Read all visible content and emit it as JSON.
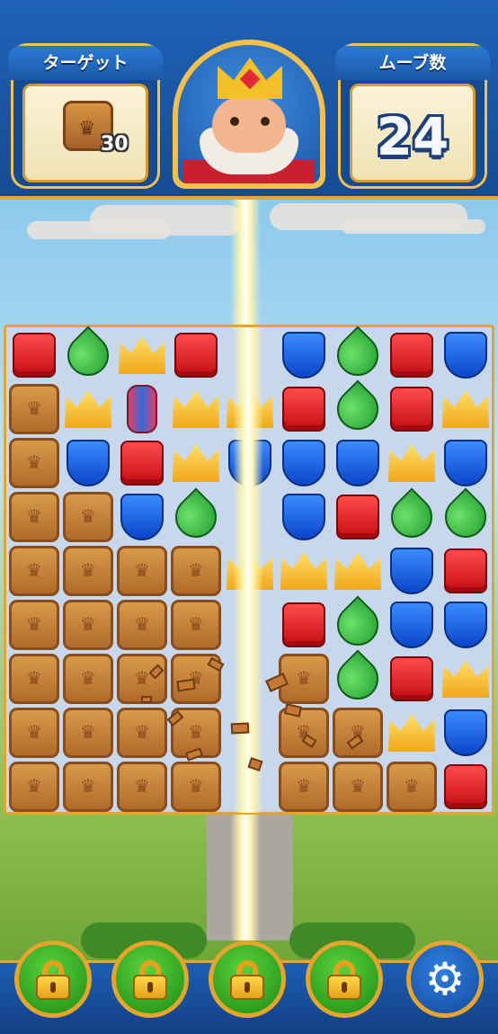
{
  "hud": {
    "target_label": "ターゲット",
    "target_count": "30",
    "moves_label": "ムーブ数",
    "moves_count": "24"
  },
  "board": {
    "columns": 9,
    "rows": 9,
    "grid": [
      [
        "red",
        "green",
        "crown",
        "red",
        "empty",
        "blue",
        "green",
        "red",
        "blue"
      ],
      [
        "box",
        "crown",
        "lantern",
        "crown",
        "crown",
        "red",
        "green",
        "red",
        "crown"
      ],
      [
        "box",
        "blue",
        "red",
        "crown",
        "blue",
        "blue",
        "blue",
        "crown",
        "blue"
      ],
      [
        "box",
        "box",
        "blue",
        "green",
        "empty",
        "blue",
        "red",
        "green",
        "green"
      ],
      [
        "box",
        "box",
        "box",
        "box",
        "crown",
        "crown",
        "crown",
        "blue",
        "red"
      ],
      [
        "box",
        "box",
        "box",
        "box",
        "empty",
        "red",
        "green",
        "blue",
        "blue"
      ],
      [
        "box",
        "box",
        "box",
        "box",
        "empty",
        "box",
        "green",
        "red",
        "crown"
      ],
      [
        "box",
        "box",
        "box",
        "box",
        "empty",
        "box",
        "box",
        "crown",
        "blue"
      ],
      [
        "box",
        "box",
        "box",
        "box",
        "empty",
        "box",
        "box",
        "box",
        "red"
      ]
    ]
  },
  "boosters": [
    {
      "icon": "lock-icon",
      "locked": true
    },
    {
      "icon": "lock-icon",
      "locked": true
    },
    {
      "icon": "lock-icon",
      "locked": true
    },
    {
      "icon": "lock-icon",
      "locked": true
    }
  ],
  "settings": {
    "icon": "gear-icon"
  }
}
